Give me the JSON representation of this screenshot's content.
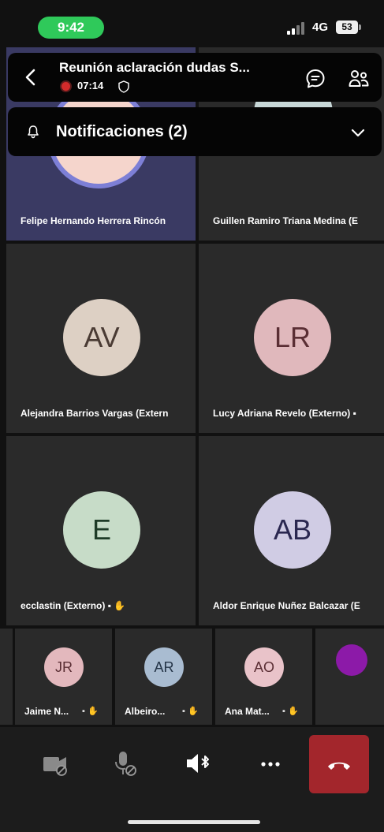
{
  "status_bar": {
    "time": "9:42",
    "network": "4G",
    "battery": "53"
  },
  "meeting": {
    "title": "Reunión aclaración dudas S...",
    "recording_time": "07:14"
  },
  "notifications": {
    "label": "Notificaciones (2)"
  },
  "tiles": [
    {
      "name": "Felipe Hernando Herrera Rincón",
      "initials": "",
      "active": true
    },
    {
      "name": "Guillen Ramiro Triana Medina (E",
      "initials": ""
    },
    {
      "name": "Alejandra Barrios Vargas (Extern",
      "initials": "AV"
    },
    {
      "name": "Lucy Adriana Revelo (Externo) ▪",
      "initials": "LR"
    },
    {
      "name": "ecclastin (Externo) ▪ ✋",
      "initials": "E"
    },
    {
      "name": "Aldor Enrique Nuñez Balcazar (E",
      "initials": "AB"
    }
  ],
  "mini_tiles": [
    {
      "name": "Jaime N...",
      "initials": "JR"
    },
    {
      "name": "Albeiro...",
      "initials": "AR"
    },
    {
      "name": "Ana Mat...",
      "initials": "AO"
    }
  ],
  "mini_icons": "▪ ✋",
  "colors": {
    "avatar_av": "#ddd0c4",
    "avatar_lr": "#e0b8bc",
    "avatar_e": "#c7dcc8",
    "avatar_ab": "#d0cce4",
    "avatar_felipe": "#f5d5cc",
    "avatar_guillen": "#c8d8d8",
    "avatar_jr": "#e3b8bd",
    "avatar_ar": "#a9bcd1",
    "avatar_ao": "#e9c3c9",
    "avatar_purple": "#8c1aa8",
    "end_call": "#a3262c",
    "active_tile": "#3a3a63",
    "status_green": "#2fc95a"
  },
  "icons": {
    "back": "chevron-left-icon",
    "record": "record-icon",
    "shield": "shield-icon",
    "chat": "chat-icon",
    "people": "people-icon",
    "bell": "bell-icon",
    "expand": "chevron-down-icon",
    "camera": "camera-off-icon",
    "mic": "mic-off-icon",
    "speaker": "speaker-bluetooth-icon",
    "more": "more-icon",
    "hangup": "hang-up-icon"
  }
}
